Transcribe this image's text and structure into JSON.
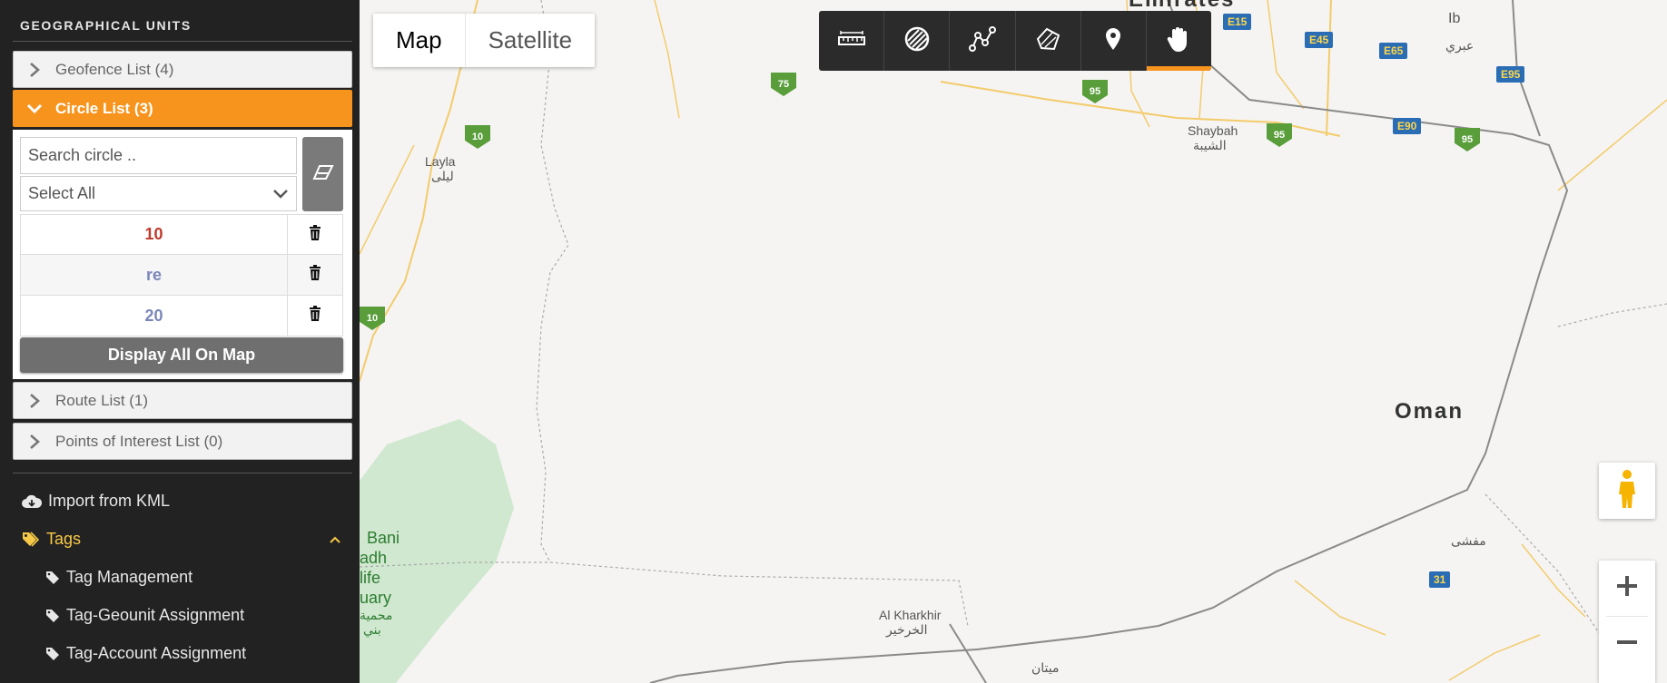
{
  "sidebar": {
    "title": "GEOGRAPHICAL UNITS",
    "geofence_list": "Geofence List (4)",
    "circle_list": "Circle List (3)",
    "route_list": "Route List (1)",
    "poi_list": "Points of Interest List (0)",
    "search_placeholder": "Search circle ..",
    "select_value": "Select All",
    "circles": [
      {
        "name": "10",
        "color": "#c0392b"
      },
      {
        "name": "re",
        "color": "#7a86b8"
      },
      {
        "name": "20",
        "color": "#7a86b8"
      }
    ],
    "display_all": "Display All On Map",
    "import_kml": "Import from KML",
    "tags": "Tags",
    "tag_management": "Tag Management",
    "tag_geounit": "Tag-Geounit Assignment",
    "tag_account": "Tag-Account Assignment"
  },
  "map": {
    "map_type": "Map",
    "satellite_type": "Satellite",
    "country_oman": "Oman",
    "country_emirates": "Emirates",
    "places": {
      "layla": "Layla",
      "layla_ar": "ليلى",
      "shaybah": "Shaybah",
      "shaybah_ar": "الشيبة",
      "al_kharkhir": "Al Kharkhir",
      "al_kharkhir_ar": "الخرخير",
      "bani": "Bani",
      "adh": "adh",
      "life": "life",
      "uary": "uary",
      "bani_ar1": "محمية",
      "bani_ar2": "بني",
      "ibri": "Ib",
      "ibri_ar": "عبري",
      "mafshi_ar": "مفشى",
      "mitan_ar": "ميتان"
    },
    "shields": {
      "r10a": "10",
      "r10b": "10",
      "r75": "75",
      "r95a": "95",
      "r95b": "95",
      "r95c": "95",
      "e15": "E15",
      "e45": "E45",
      "e65": "E65",
      "e95": "E95",
      "e90": "E90",
      "r31": "31"
    },
    "accent": "#f7941d"
  }
}
